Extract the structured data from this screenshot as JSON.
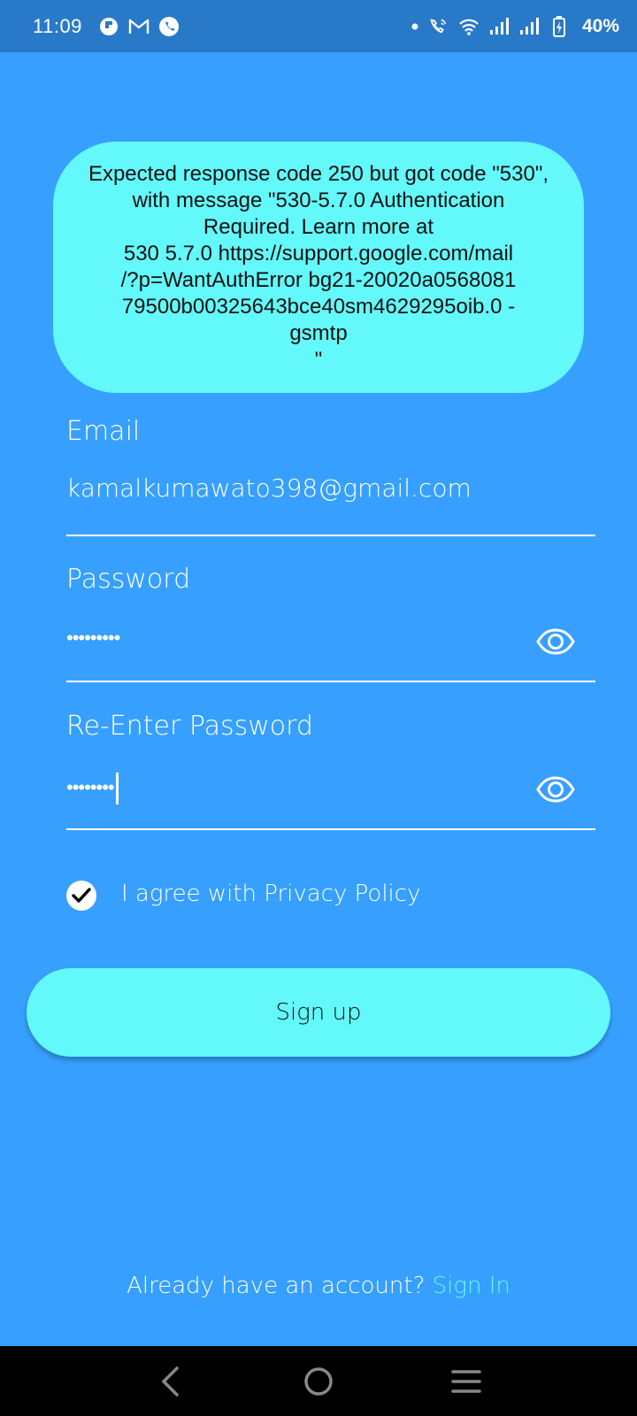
{
  "status_bar": {
    "time": "11:09",
    "battery": "40%",
    "left_icons": [
      "flipboard-icon",
      "gmail-icon",
      "phone-icon"
    ],
    "right_icons": [
      "dot-icon",
      "wifi-calling-icon",
      "wifi-icon",
      "signal-icon",
      "signal-icon",
      "battery-charging-icon"
    ]
  },
  "toast": {
    "message": "Expected response code 250 but got code \"530\", with message \"530-5.7.0 Authentication Required. Learn more at\n530 5.7.0  https://support.google.com/mail\n/?p=WantAuthError bg21-20020a0568081\n79500b00325643bce40sm4629295oib.0 -\ngsmtp\n\""
  },
  "form": {
    "email_label": "Email",
    "email_value": "kamalkumawato398@gmail.com",
    "password_label": "Password",
    "password_value": "•••••••••",
    "reenter_label": "Re-Enter Password",
    "reenter_value": "••••••••",
    "agree_label": "I agree with Privacy Policy",
    "agree_checked": true,
    "signup_label": "Sign up"
  },
  "footer": {
    "prompt": "Already have an account? ",
    "signin_label": "Sign In"
  },
  "colors": {
    "background": "#37A0FF",
    "status_bar": "#2979C9",
    "accent": "#63F8FA"
  }
}
